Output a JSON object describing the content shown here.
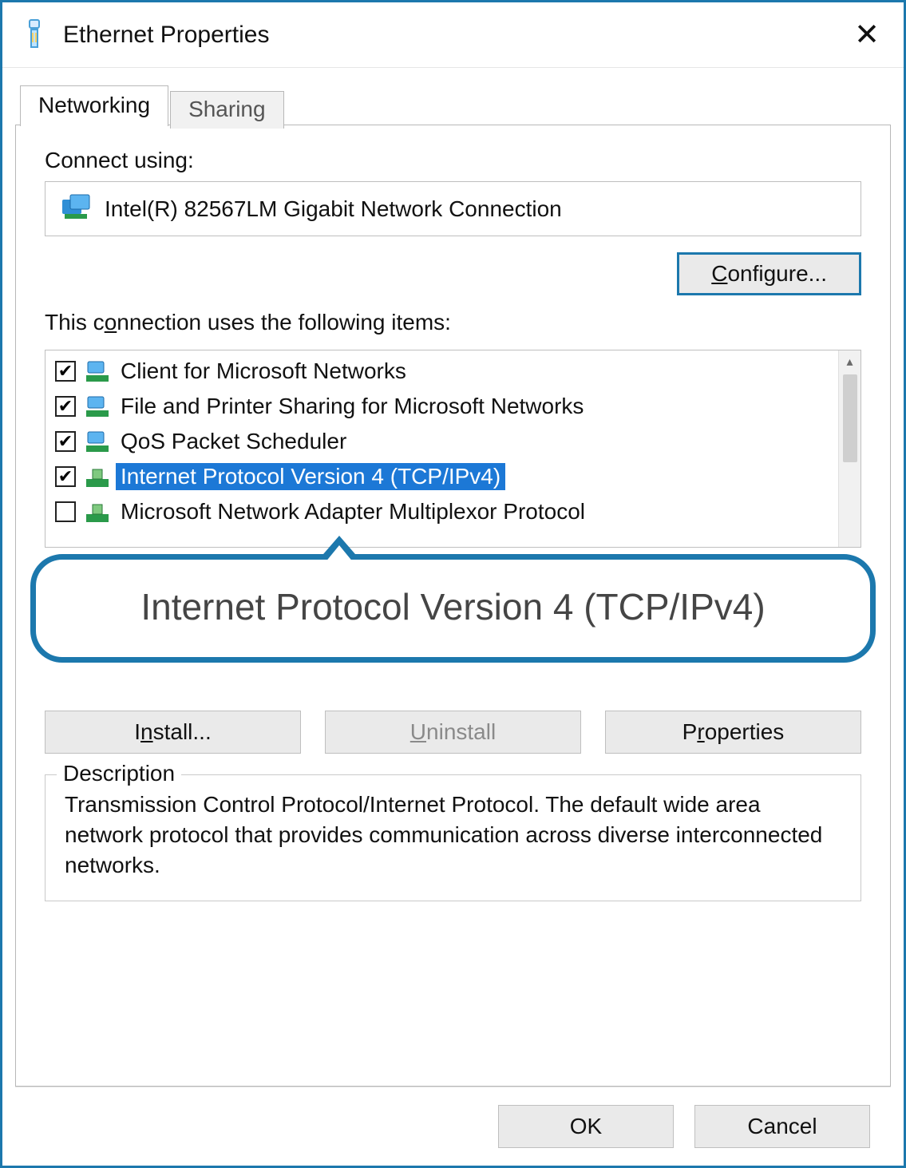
{
  "window": {
    "title": "Ethernet Properties"
  },
  "tabs": {
    "networking": "Networking",
    "sharing": "Sharing"
  },
  "connect_label": "Connect using:",
  "adapter": "Intel(R) 82567LM Gigabit Network Connection",
  "configure_btn": "Configure...",
  "items_label": "This connection uses the following items:",
  "items": [
    {
      "checked": true,
      "label": "Client for Microsoft Networks",
      "icon": "net"
    },
    {
      "checked": true,
      "label": "File and Printer Sharing for Microsoft Networks",
      "icon": "net"
    },
    {
      "checked": true,
      "label": "QoS Packet Scheduler",
      "icon": "net"
    },
    {
      "checked": true,
      "label": "Internet Protocol Version 4 (TCP/IPv4)",
      "icon": "proto",
      "selected": true
    },
    {
      "checked": false,
      "label": "Microsoft Network Adapter Multiplexor Protocol",
      "icon": "proto"
    }
  ],
  "callout": "Internet Protocol Version 4 (TCP/IPv4)",
  "buttons": {
    "install": "Install...",
    "uninstall": "Uninstall",
    "properties": "Properties"
  },
  "description": {
    "title": "Description",
    "text": "Transmission Control Protocol/Internet Protocol. The default wide area network protocol that provides communication across diverse interconnected networks."
  },
  "footer": {
    "ok": "OK",
    "cancel": "Cancel"
  }
}
